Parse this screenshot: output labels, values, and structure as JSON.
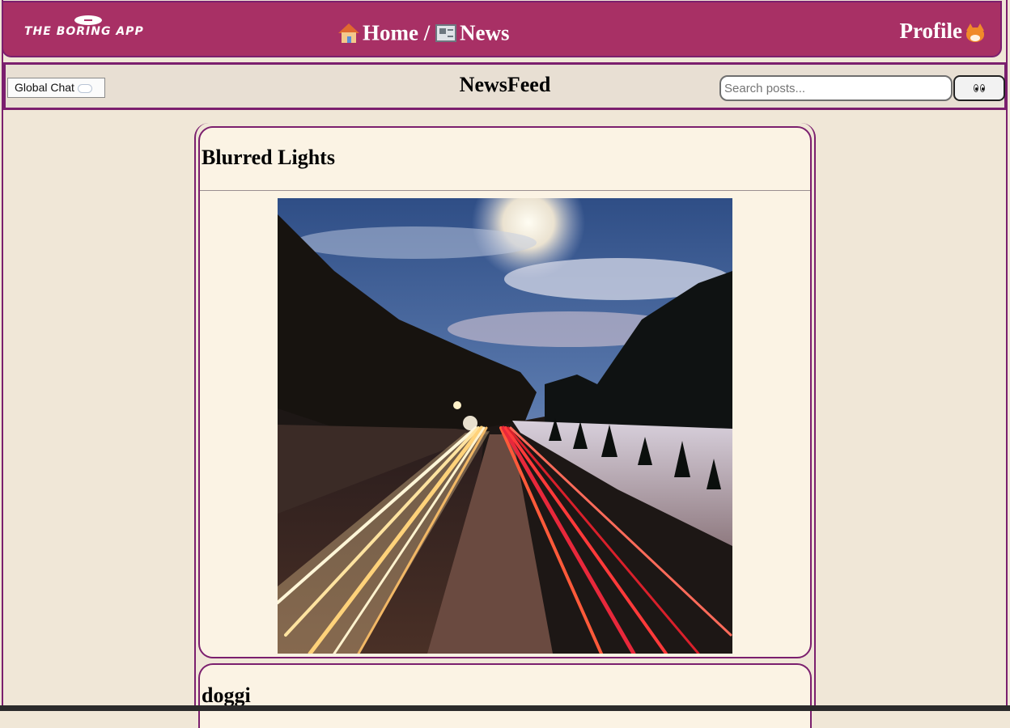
{
  "topbar": {
    "logo_text": "THE BORING APP",
    "breadcrumb": {
      "home": "Home",
      "separator": "/",
      "current": "News"
    },
    "profile_label": "Profile"
  },
  "subbar": {
    "chat_button_label": "Global Chat",
    "title": "NewsFeed",
    "search_placeholder": "Search posts...",
    "search_value": ""
  },
  "posts": [
    {
      "title": "Blurred Lights",
      "image_icon": "highway-light-trails-photo"
    },
    {
      "title": "doggi"
    }
  ],
  "colors": {
    "brand": "#a83065",
    "border": "#7b1f6e",
    "page_bg": "#f0e7d7",
    "card_bg": "#fbf3e4",
    "subbar_bg": "#e8dfd3"
  }
}
